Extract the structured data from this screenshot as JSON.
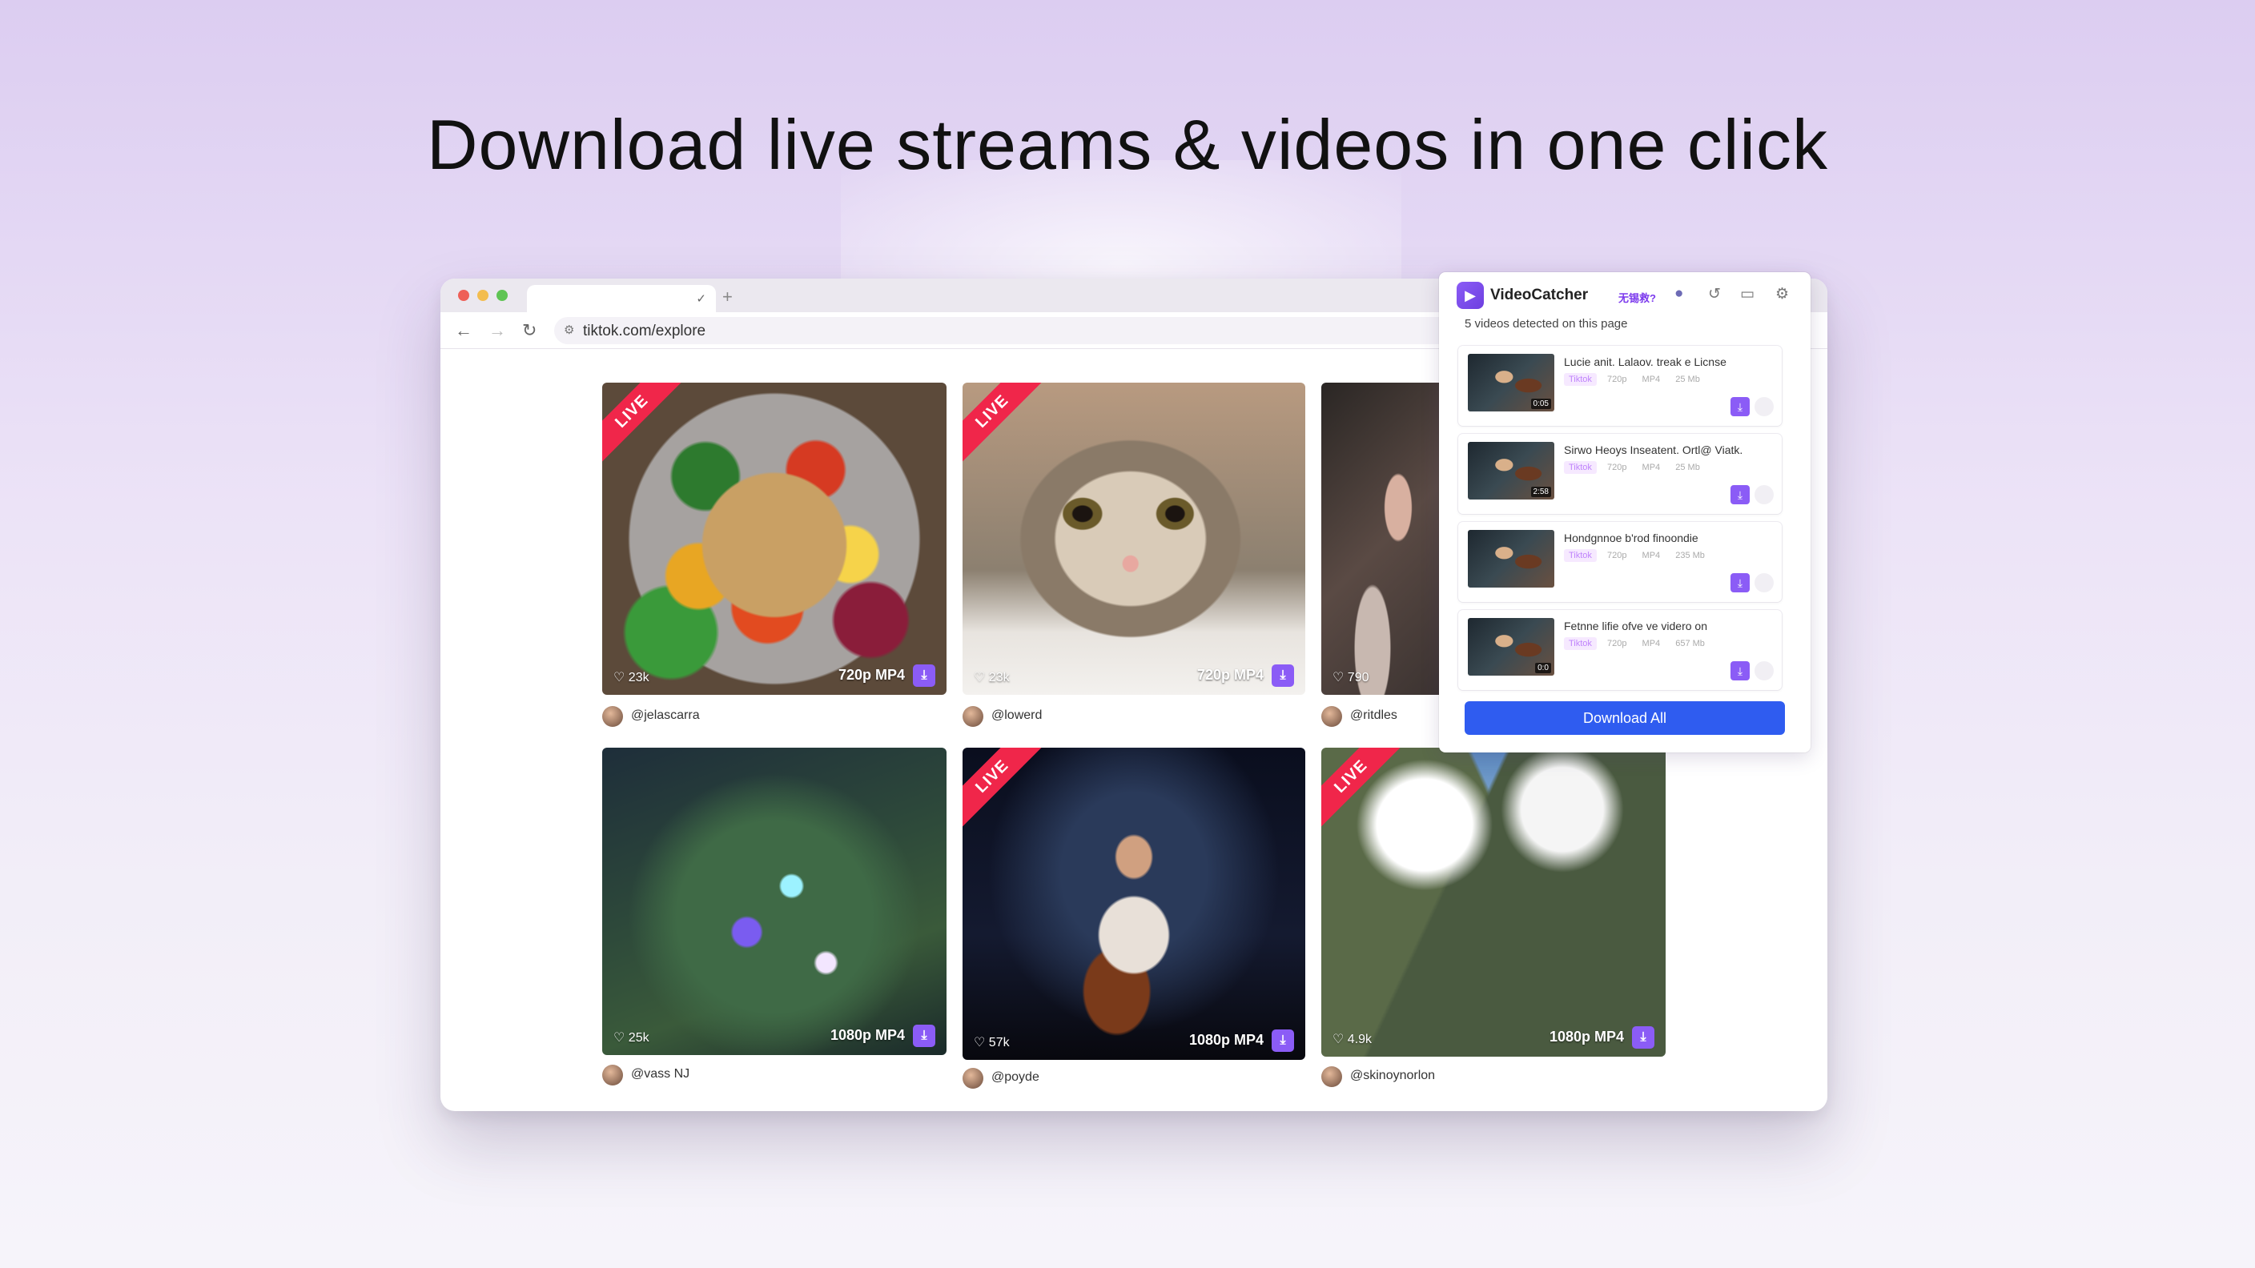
{
  "headline": "Download live streams & videos in one click",
  "browser": {
    "url": "tiktok.com/explore",
    "tab_close_glyph": "✓",
    "new_tab_glyph": "+"
  },
  "grid": [
    {
      "live": true,
      "live_label": "LIVE",
      "likes": "♡ 23k",
      "quality": "720p MP4",
      "author": "@jelascarra"
    },
    {
      "live": true,
      "live_label": "LIVE",
      "likes": "♡ 23k",
      "quality": "720p MP4",
      "author": "@lowerd"
    },
    {
      "live": false,
      "live_label": "",
      "likes": "♡ 790",
      "quality": "",
      "author": "@ritdles"
    },
    {
      "live": false,
      "live_label": "",
      "likes": "♡ 25k",
      "quality": "1080p MP4",
      "author": "@vass NJ"
    },
    {
      "live": true,
      "live_label": "LIVE",
      "likes": "♡ 57k",
      "quality": "1080p MP4",
      "author": "@poyde"
    },
    {
      "live": true,
      "live_label": "LIVE",
      "likes": "♡ 4.9k",
      "quality": "1080p MP4",
      "author": "@skinoynorlon"
    }
  ],
  "extension": {
    "name": "VideoCatcher",
    "promo": "无锡救?",
    "detected": "5 videos detected on this page",
    "items": [
      {
        "title": "Lucie anit. Lalaov. treak e Licnse",
        "source": "Tiktok",
        "quality": "720p",
        "format": "MP4",
        "size": "25 Mb",
        "badge": "0:05"
      },
      {
        "title": "Sirwo Heoys Inseatent. Ortl@ Viatk.",
        "source": "Tiktok",
        "quality": "720p",
        "format": "MP4",
        "size": "25 Mb",
        "badge": "2:58"
      },
      {
        "title": "Hondgnnoe b'rod finoondie",
        "source": "Tiktok",
        "quality": "720p",
        "format": "MP4",
        "size": "235 Mb",
        "badge": ""
      },
      {
        "title": "Fetnne lifie ofve ve videro on",
        "source": "Tiktok",
        "quality": "720p",
        "format": "MP4",
        "size": "657 Mb",
        "badge": "0:0"
      }
    ],
    "download_all": "Download All"
  },
  "icons": {
    "back": "arrow-left-icon",
    "forward": "arrow-right-icon",
    "reload": "reload-icon",
    "site_info": "site-info-icon",
    "download": "download-icon"
  },
  "colors": {
    "accent_purple": "#8b5cf6",
    "live_red": "#f0264a",
    "primary_blue": "#2f5cf0"
  }
}
